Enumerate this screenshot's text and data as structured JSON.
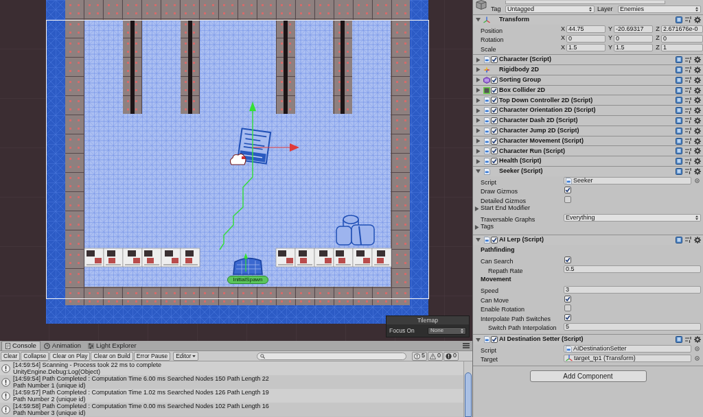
{
  "scene": {
    "spawn_label": "InitialSpawn",
    "overlay": {
      "title": "Tilemap",
      "focus_label": "Focus On",
      "focus_value": "None"
    }
  },
  "console": {
    "tabs": [
      {
        "label": "Console",
        "kind": "console",
        "selected": true
      },
      {
        "label": "Animation",
        "kind": "animation",
        "selected": false
      },
      {
        "label": "Light Explorer",
        "kind": "light",
        "selected": false
      }
    ],
    "toolbar": [
      "Clear",
      "Collapse",
      "Clear on Play",
      "Clear on Build",
      "Error Pause"
    ],
    "mode": "Editor",
    "counts": [
      {
        "kind": "info",
        "count": "5"
      },
      {
        "kind": "warning",
        "count": "0"
      },
      {
        "kind": "error",
        "count": "0"
      }
    ],
    "logs": [
      {
        "text": "[14:59:54] Scanning - Process took 22 ms to complete",
        "detail": "UnityEngine.Debug:Log(Object)"
      },
      {
        "text": "[14:59:54] Path Completed : Computation Time 6.00 ms Searched Nodes 150 Path Length 22",
        "detail": "Path Number 1 (unique id)"
      },
      {
        "text": "[14:59:57] Path Completed : Computation Time 1.02 ms Searched Nodes 126 Path Length 19",
        "detail": "Path Number 2 (unique id)"
      },
      {
        "text": "[14:59:58] Path Completed : Computation Time 0.00 ms Searched Nodes 102 Path Length 16",
        "detail": "Path Number 3 (unique id)"
      }
    ]
  },
  "inspector": {
    "tag": {
      "label": "Tag",
      "value": "Untagged"
    },
    "layer": {
      "label": "Layer",
      "value": "Enemies"
    },
    "transform": {
      "title": "Transform",
      "kind": "transform",
      "expanded": true,
      "rows": [
        {
          "label": "Position",
          "values": [
            {
              "axis": "X",
              "value": "44.75"
            },
            {
              "axis": "Y",
              "value": "-20.69317"
            },
            {
              "axis": "Z",
              "value": "2.671676e-0"
            }
          ]
        },
        {
          "label": "Rotation",
          "values": [
            {
              "axis": "X",
              "value": "0"
            },
            {
              "axis": "Y",
              "value": "0"
            },
            {
              "axis": "Z",
              "value": "0"
            }
          ]
        },
        {
          "label": "Scale",
          "values": [
            {
              "axis": "X",
              "value": "1.5"
            },
            {
              "axis": "Y",
              "value": "1.5"
            },
            {
              "axis": "Z",
              "value": "1"
            }
          ]
        }
      ]
    },
    "components": [
      {
        "title": "Character (Script)",
        "kind": "script",
        "enabled": true,
        "expanded": false
      },
      {
        "title": "Rigidbody 2D",
        "kind": "rigidbody",
        "expanded": false
      },
      {
        "title": "Sorting Group",
        "kind": "sorting",
        "enabled": true,
        "expanded": false
      },
      {
        "title": "Box Collider 2D",
        "kind": "collider",
        "enabled": true,
        "expanded": false
      },
      {
        "title": "Top Down Controller 2D (Script)",
        "kind": "script",
        "enabled": true,
        "expanded": false
      },
      {
        "title": "Character Orientation 2D (Script)",
        "kind": "script",
        "enabled": true,
        "expanded": false
      },
      {
        "title": "Character Dash 2D (Script)",
        "kind": "script",
        "enabled": true,
        "expanded": false
      },
      {
        "title": "Character Jump 2D (Script)",
        "kind": "script",
        "enabled": true,
        "expanded": false
      },
      {
        "title": "Character Movement (Script)",
        "kind": "script",
        "enabled": true,
        "expanded": false
      },
      {
        "title": "Character Run (Script)",
        "kind": "script",
        "enabled": true,
        "expanded": false
      },
      {
        "title": "Health (Script)",
        "kind": "script",
        "enabled": true,
        "expanded": false
      },
      {
        "title": "Seeker (Script)",
        "kind": "script",
        "expanded": true,
        "fields": [
          {
            "kind": "script_object",
            "label": "Script",
            "value": "Seeker"
          },
          {
            "kind": "checkbox",
            "label": "Draw Gizmos",
            "checked": true
          },
          {
            "kind": "checkbox",
            "label": "Detailed Gizmos",
            "checked": false
          },
          {
            "kind": "foldout",
            "label": "Start End Modifier",
            "expanded": false
          },
          {
            "kind": "dropdown",
            "label": "Traversable Graphs",
            "value": "Everything"
          },
          {
            "kind": "foldout",
            "label": "Tags",
            "expanded": false
          }
        ]
      },
      {
        "title": "AI Lerp (Script)",
        "kind": "script",
        "enabled": true,
        "expanded": true,
        "fields": [
          {
            "kind": "header",
            "label": "Pathfinding"
          },
          {
            "kind": "checkbox",
            "label": "Can Search",
            "checked": true,
            "children": [
              {
                "kind": "number",
                "label": "Repath Rate",
                "value": "0.5"
              }
            ]
          },
          {
            "kind": "header",
            "label": "Movement"
          },
          {
            "kind": "number",
            "label": "Speed",
            "value": "3"
          },
          {
            "kind": "checkbox",
            "label": "Can Move",
            "checked": true
          },
          {
            "kind": "checkbox",
            "label": "Enable Rotation",
            "checked": false
          },
          {
            "kind": "checkbox",
            "label": "Interpolate Path Switches",
            "checked": true,
            "children": [
              {
                "kind": "number",
                "label": "Switch Path Interpolation",
                "value": "5"
              }
            ]
          }
        ]
      },
      {
        "title": "AI Destination Setter (Script)",
        "kind": "script",
        "enabled": true,
        "expanded": true,
        "fields": [
          {
            "kind": "script_object",
            "label": "Script",
            "value": "AIDestinationSetter"
          },
          {
            "kind": "transform_object",
            "label": "Target",
            "value": "target_tp1 (Transform)"
          }
        ]
      }
    ],
    "add_component": "Add Component"
  }
}
